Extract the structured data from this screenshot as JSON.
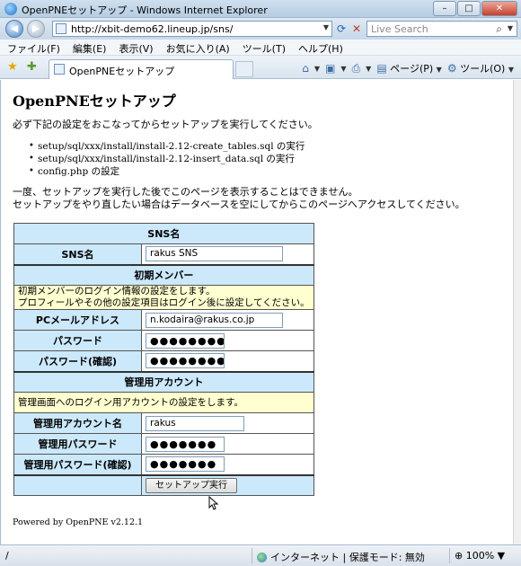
{
  "window": {
    "title": "OpenPNEセットアップ - Windows Internet Explorer",
    "controls": {
      "minimize": "–",
      "maximize": "□",
      "close": "✕"
    }
  },
  "addressbar": {
    "url": "http://xbit-demo62.lineup.jp/sns/",
    "search_placeholder": "Live Search"
  },
  "menubar": {
    "items": [
      "ファイル(F)",
      "編集(E)",
      "表示(V)",
      "お気に入り(A)",
      "ツール(T)",
      "ヘルプ(H)"
    ]
  },
  "tabbar": {
    "tab_label": "OpenPNEセットアップ",
    "page_menu": "ページ(P)",
    "tools_menu": "ツール(O)"
  },
  "page": {
    "heading": "OpenPNEセットアップ",
    "intro": "必ず下記の設定をおこなってからセットアップを実行してください。",
    "steps": [
      "setup/sql/xxx/install/install-2.12-create_tables.sql の実行",
      "setup/sql/xxx/install/install-2.12-insert_data.sql の実行",
      "config.php の設定"
    ],
    "warning_line1": "一度、セットアップを実行した後でこのページを表示することはできません。",
    "warning_line2": "セットアップをやり直したい場合はデータベースを空にしてからこのページへアクセスしてください。",
    "form": {
      "sns_section": "SNS名",
      "sns_name_label": "SNS名",
      "sns_name_value": "rakus SNS",
      "member_section": "初期メンバー",
      "member_note_line1": "初期メンバーのログイン情報の設定をします。",
      "member_note_line2": "プロフィールやその他の設定項目はログイン後に設定してください。",
      "email_label": "PCメールアドレス",
      "email_value": "n.kodaira@rakus.co.jp",
      "password_label": "パスワード",
      "password_value": "●●●●●●●●",
      "password_confirm_label": "パスワード(確認)",
      "password_confirm_value": "●●●●●●●●",
      "admin_section": "管理用アカウント",
      "admin_note": "管理画面へのログイン用アカウントの設定をします。",
      "admin_account_label": "管理用アカウント名",
      "admin_account_value": "rakus",
      "admin_password_label": "管理用パスワード",
      "admin_password_value": "●●●●●●●",
      "admin_password_confirm_label": "管理用パスワード(確認)",
      "admin_password_confirm_value": "●●●●●●●",
      "submit_label": "セットアップ実行"
    },
    "powered_by": "Powered by OpenPNE v2.12.1"
  },
  "statusbar": {
    "status_text": "/",
    "zone": "インターネット | 保護モード: 無効",
    "zoom": "100%"
  }
}
